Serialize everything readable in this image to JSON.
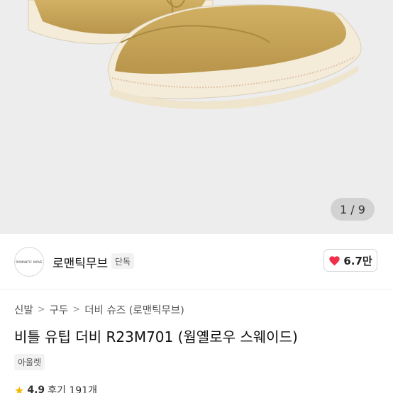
{
  "gallery": {
    "current_page": "1",
    "total_pages": "9",
    "counter_text": "1 / 9"
  },
  "seller": {
    "logo_text": "ROMANTIC MOVE",
    "name": "로맨틱무브",
    "badge": "단독",
    "like_count": "6.7만"
  },
  "breadcrumb": [
    "신발",
    "구두",
    "더비 슈즈 (로맨틱무브)"
  ],
  "product": {
    "title": "비틀 유팁 더비 R23M701 (웜옐로우 스웨이드)",
    "tag": "아울렛"
  },
  "rating": {
    "score": "4.9",
    "reviews": "후기 191개"
  },
  "colors": {
    "heart": "#f0304a",
    "shoe": "#c9a656",
    "sole": "#f3ead6"
  }
}
